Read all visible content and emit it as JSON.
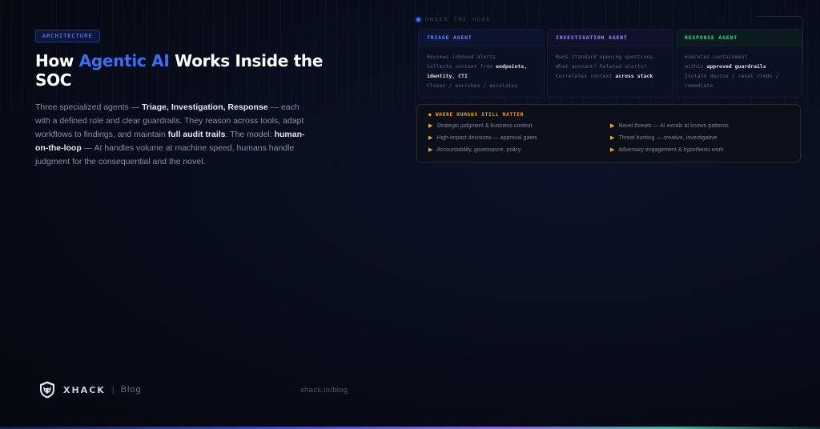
{
  "tag": "ARCHITECTURE",
  "headline": {
    "pre": "How ",
    "accent": "Agentic AI",
    "post": " Works Inside the SOC"
  },
  "description": {
    "p1": "Three specialized agents — ",
    "b1": "Triage, Investigation, Response",
    "p2": " — each with a defined role and clear guardrails. They reason across tools, adapt workflows to findings, and maintain ",
    "b2": "full audit trails",
    "p3": ". The model: ",
    "b3": "human-on-the-loop",
    "p4": " — AI handles volume at machine speed, humans handle judgment for the consequential and the novel."
  },
  "hood_label": "UNDER THE HOOD",
  "agents": [
    {
      "title": "TRIAGE AGENT",
      "l1": "Reviews inbound alerts",
      "l2": "Collects context from ",
      "l2b": "endpoints,",
      "l3b": "identity, CTI",
      "l4": "Closes / enriches / escalates"
    },
    {
      "title": "INVESTIGATION AGENT",
      "l1": "Runs standard opening questions",
      "l2": "What account? Related alerts?",
      "l3": "Correlates context ",
      "l3b": "across stack"
    },
    {
      "title": "RESPONSE AGENT",
      "l1": "Executes containment",
      "l2": "within ",
      "l2b": "approved guardrails",
      "l3": "Isolate device / reset creds /",
      "l4": "remediate"
    }
  ],
  "humans": {
    "title": "WHERE HUMANS STILL MATTER",
    "items": [
      "Strategic judgment & business context",
      "High-impact decisions — approval gates",
      "Accountability, governance, policy",
      "Novel threats — AI excels at known patterns",
      "Threat hunting — creative, investigative",
      "Adversary engagement & hypothesis work"
    ]
  },
  "brand": {
    "name": "XHACK",
    "separator": "|",
    "sub": "Blog"
  },
  "url": "xhack.io/blog",
  "colors": {
    "accent_blue": "#3b6ff0",
    "triage": "#5f8dff",
    "investigation": "#a38bff",
    "response": "#3ed39b",
    "humans_orange": "#f5a623"
  }
}
